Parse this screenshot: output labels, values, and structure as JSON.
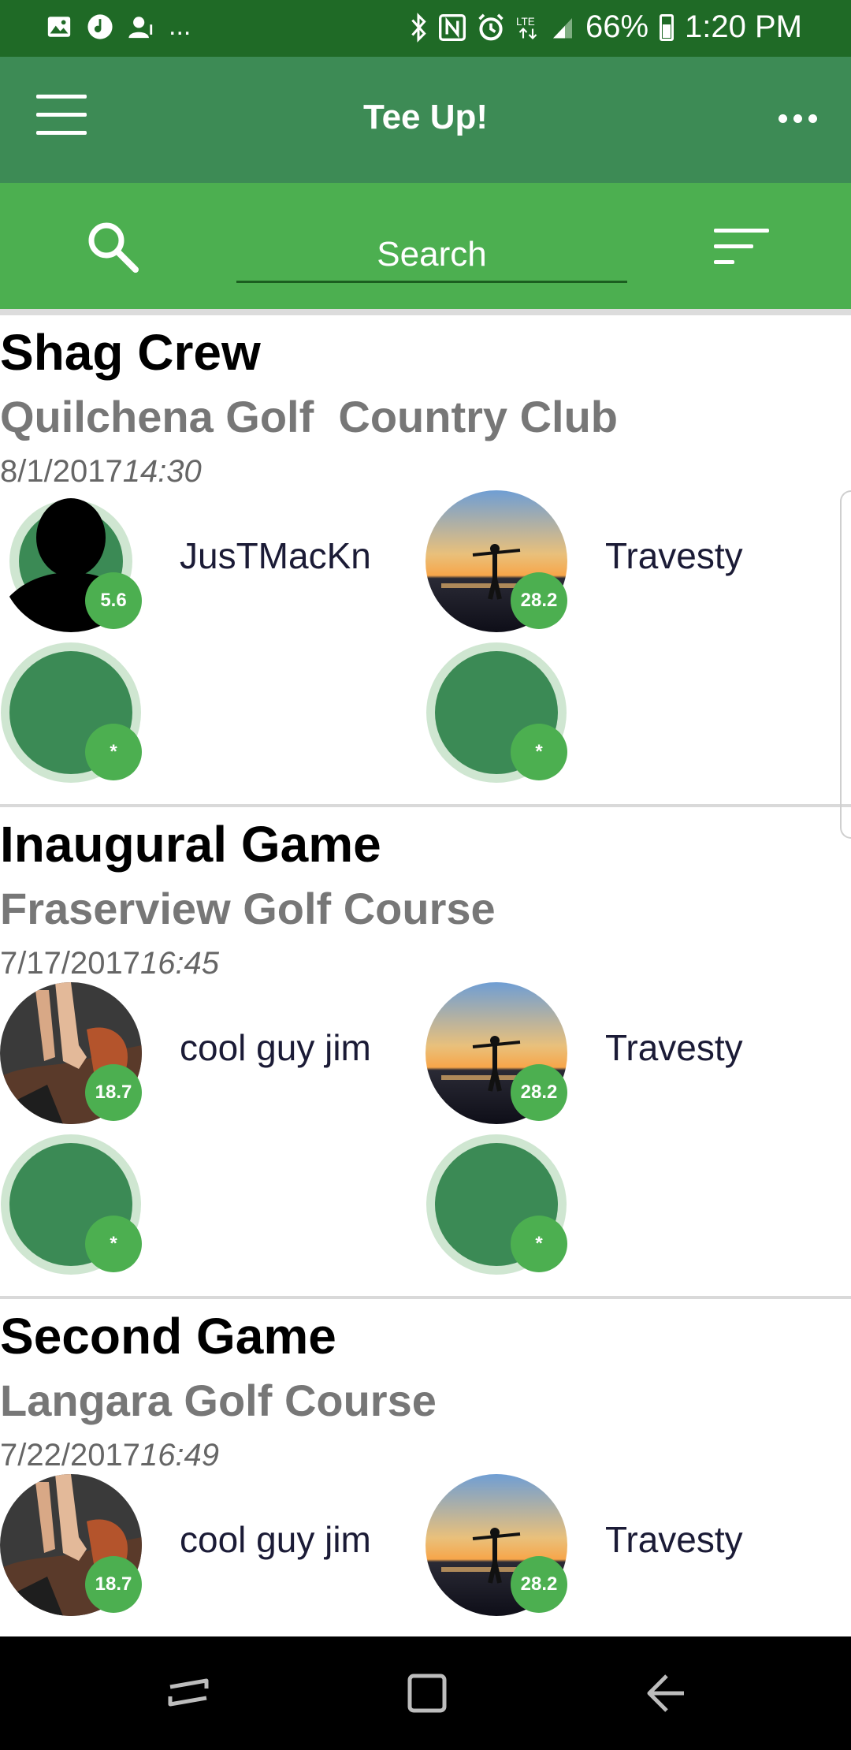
{
  "status_bar": {
    "left_icons": [
      "image-icon",
      "music-icon",
      "account-notification-icon"
    ],
    "overflow": "...",
    "right_icons": [
      "bluetooth-icon",
      "nfc-icon",
      "alarm-icon",
      "lte-icon",
      "signal-icon"
    ],
    "battery": "66%",
    "time": "1:20 PM"
  },
  "app_bar": {
    "title": "Tee Up!",
    "menu_icon": "hamburger-menu-icon",
    "more_icon": "more-options-icon"
  },
  "search": {
    "placeholder": "Search",
    "icon": "search-icon",
    "sort_icon": "sort-icon"
  },
  "games": [
    {
      "title": "Shag Crew",
      "course": "Quilchena Golf  Country Club",
      "date": "8/1/2017",
      "time": "14:30",
      "players": [
        {
          "name": "JusTMacKn",
          "handicap": "5.6",
          "avatar": "default-silhouette"
        },
        {
          "name": "Travesty",
          "handicap": "28.2",
          "avatar": "sunset-beach-photo"
        }
      ],
      "open_slots": [
        "*",
        "*"
      ]
    },
    {
      "title": "Inaugural Game",
      "course": "Fraserview Golf Course",
      "date": "7/17/2017",
      "time": "16:45",
      "players": [
        {
          "name": "cool guy jim",
          "handicap": "18.7",
          "avatar": "hand-photo"
        },
        {
          "name": "Travesty",
          "handicap": "28.2",
          "avatar": "sunset-beach-photo"
        }
      ],
      "open_slots": [
        "*",
        "*"
      ]
    },
    {
      "title": "Second Game",
      "course": "Langara Golf Course",
      "date": "7/22/2017",
      "time": "16:49",
      "players": [
        {
          "name": "cool guy jim",
          "handicap": "18.7",
          "avatar": "hand-photo"
        },
        {
          "name": "Travesty",
          "handicap": "28.2",
          "avatar": "sunset-beach-photo"
        }
      ],
      "open_slots": []
    }
  ],
  "nav_bar": {
    "icons": [
      "recent-apps-icon",
      "home-icon",
      "back-icon"
    ]
  },
  "colors": {
    "status_bar": "#1f6a26",
    "app_bar": "#3d8b55",
    "search_bar": "#4caf50",
    "badge": "#4caf50",
    "empty_slot": "#3b8a55"
  }
}
